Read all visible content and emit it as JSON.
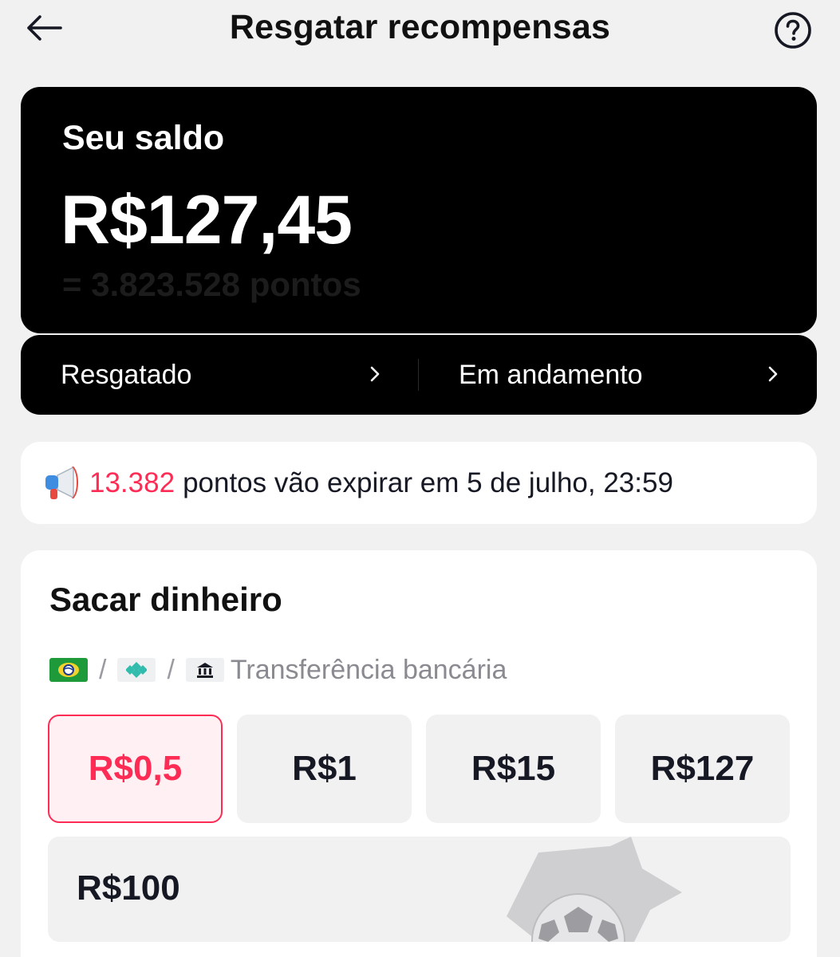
{
  "header": {
    "title": "Resgatar recompensas"
  },
  "balance": {
    "label": "Seu saldo",
    "amount": "R$127,45",
    "points": "= 3.823.528 pontos"
  },
  "links": [
    {
      "label": "Resgatado"
    },
    {
      "label": "Em andamento"
    }
  ],
  "notice": {
    "points": "13.382",
    "text": "pontos vão expirar em 5 de julho, 23:59"
  },
  "withdraw": {
    "title": "Sacar dinheiro",
    "methods": {
      "separator": "/",
      "bank_label": "Transferência bancária"
    },
    "amounts": [
      {
        "label": "R$0,5",
        "selected": true
      },
      {
        "label": "R$1",
        "selected": false
      },
      {
        "label": "R$15",
        "selected": false
      },
      {
        "label": "R$127",
        "selected": false
      }
    ],
    "featured_amount": "R$100"
  },
  "colors": {
    "accent": "#fe2c55",
    "card_dark": "#000000",
    "background": "#f1f1f2",
    "text": "#161823"
  },
  "icons": [
    "back-arrow-icon",
    "help-circle-icon",
    "chevron-right-icon",
    "megaphone-icon",
    "boleto-icon",
    "pix-icon",
    "bank-icon",
    "soccer-ball-icon"
  ]
}
